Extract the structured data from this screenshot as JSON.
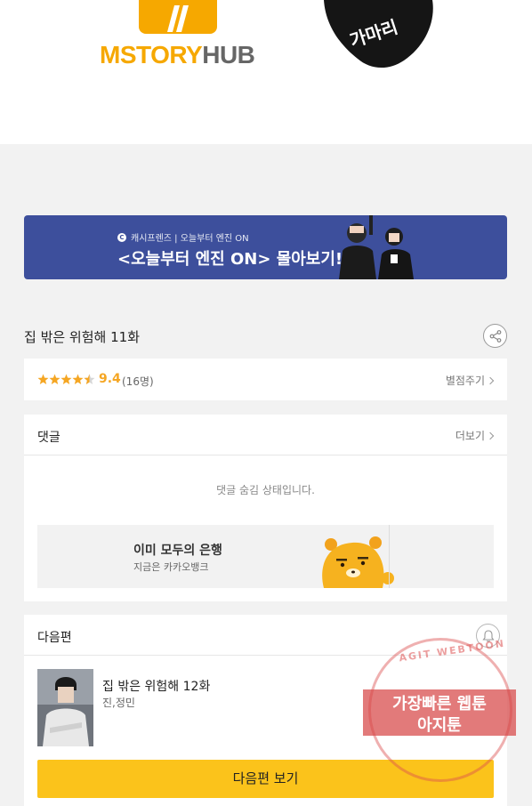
{
  "logos": {
    "mstoryhub_part1": "MSTORY",
    "mstoryhub_part2": "HUB",
    "brand_color": "#f6a800",
    "blob_text": "가마리"
  },
  "banner": {
    "small_text": "캐시프렌즈 | 오늘부터 엔진 ON",
    "big_text": "<오늘부터 엔진 ON> 몰아보기!",
    "bg_color": "#3d4f9c"
  },
  "episode": {
    "title": "집 밖은 위험해 11화"
  },
  "rating": {
    "stars": 4.5,
    "score": "9.4",
    "count": "(16명)",
    "rate_label": "별점주기"
  },
  "comments": {
    "title": "댓글",
    "more_label": "더보기",
    "hidden_message": "댓글 숨김 상태입니다."
  },
  "ad": {
    "title": "이미 모두의 은행",
    "subtitle": "지금은 카카오뱅크"
  },
  "next": {
    "header": "다음편",
    "episode_title": "집 밖은 위험해 12화",
    "authors": "진,정민",
    "button_label": "다음편 보기",
    "button_color": "#fbc31b"
  },
  "watermark": {
    "arc_text": "AGIT WEBTOON",
    "line1": "가장빠른 웹툰",
    "line2": "아지툰"
  },
  "icons": {
    "share": "share-icon",
    "bell": "bell-icon",
    "star": "star-icon"
  }
}
